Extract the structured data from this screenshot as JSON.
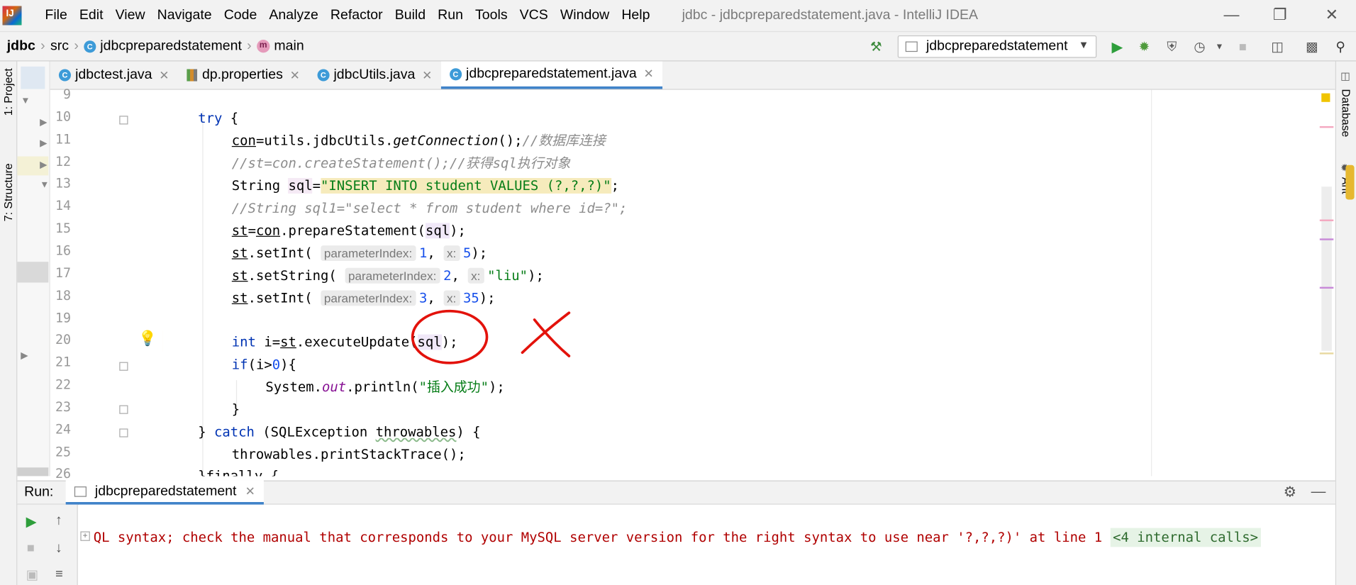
{
  "menu": {
    "items": [
      "File",
      "Edit",
      "View",
      "Navigate",
      "Code",
      "Analyze",
      "Refactor",
      "Build",
      "Run",
      "Tools",
      "VCS",
      "Window",
      "Help"
    ],
    "window_title": "jdbc - jdbcpreparedstatement.java - IntelliJ IDEA"
  },
  "breadcrumb": {
    "project": "jdbc",
    "folder": "src",
    "file": "jdbcpreparedstatement",
    "method": "main"
  },
  "run_config": "jdbcpreparedstatement",
  "tabs": [
    {
      "label": "jdbctest.java",
      "icon": "class-icon"
    },
    {
      "label": "dp.properties",
      "icon": "properties-icon"
    },
    {
      "label": "jdbcUtils.java",
      "icon": "class-icon"
    },
    {
      "label": "jdbcpreparedstatement.java",
      "icon": "class-icon",
      "active": true
    }
  ],
  "side_tabs": {
    "project": "1: Project",
    "structure": "7: Structure",
    "database": "Database",
    "ant": "Ant"
  },
  "line_numbers": [
    "9",
    "10",
    "11",
    "12",
    "13",
    "14",
    "15",
    "16",
    "17",
    "18",
    "19",
    "20",
    "21",
    "22",
    "23",
    "24",
    "25",
    "26"
  ],
  "code": {
    "l10_kw": "try",
    "l10_rest": " {",
    "l11_con": "con",
    "l11_mid": "=utils.jdbcUtils.",
    "l11_fn": "getConnection",
    "l11_end": "();",
    "l11_cmt": "//数据库连接",
    "l12": "//st=con.createStatement();//获得sql执行对象",
    "l13_a": "String ",
    "l13_var": "sql",
    "l13_eq": "=",
    "l13_str": "\"INSERT INTO student VALUES (?,?,?)\"",
    "l13_end": ";",
    "l14": "//String sql1=\"select * from student where id=?\";",
    "l15_st": "st",
    "l15_eq": "=",
    "l15_con": "con",
    "l15_mid": ".prepareStatement(",
    "l15_arg": "sql",
    "l15_end": ");",
    "l16_call": ".setInt( ",
    "l16_h1": "parameterIndex:",
    "l16_v1": "1",
    "l16_h2": "x:",
    "l16_v2": "5",
    "l16_end": ");",
    "l17_call": ".setString( ",
    "l17_h1": "parameterIndex:",
    "l17_v1": "2",
    "l17_h2": "x:",
    "l17_v2": "\"liu\"",
    "l17_end": ");",
    "l18_call": ".setInt( ",
    "l18_h1": "parameterIndex:",
    "l18_v1": "3",
    "l18_h2": "x:",
    "l18_v2": "35",
    "l18_end": ");",
    "l20_kw": "int",
    "l20_a": " i=",
    "l20_st": "st",
    "l20_b": ".executeUpdate(",
    "l20_arg": "sql",
    "l20_end": ");",
    "l21_kw": "if",
    "l21_a": "(i>",
    "l21_num": "0",
    "l21_b": "){",
    "l22_a": "System.",
    "l22_out": "out",
    "l22_b": ".println(",
    "l22_str": "\"插入成功\"",
    "l22_end": ");",
    "l23": "}",
    "l24_a": "} ",
    "l24_kw": "catch",
    "l24_b": " (SQLException ",
    "l24_var": "throwables",
    "l24_c": ") {",
    "l25": "throwables.printStackTrace();",
    "l26": "}finally {"
  },
  "run_panel": {
    "label": "Run:",
    "tab": "jdbcpreparedstatement",
    "console_text": "QL syntax; check the manual that corresponds to your MySQL server version for the right syntax to use near '?,?,?)' at line 1",
    "internal_calls": "<4 internal calls>"
  },
  "colors": {
    "keyword": "#0033b3",
    "string": "#067d17",
    "number": "#1750eb",
    "comment": "#8c8c8c",
    "error": "#b00000",
    "annotation": "#e3120b",
    "accent": "#4083c9"
  }
}
